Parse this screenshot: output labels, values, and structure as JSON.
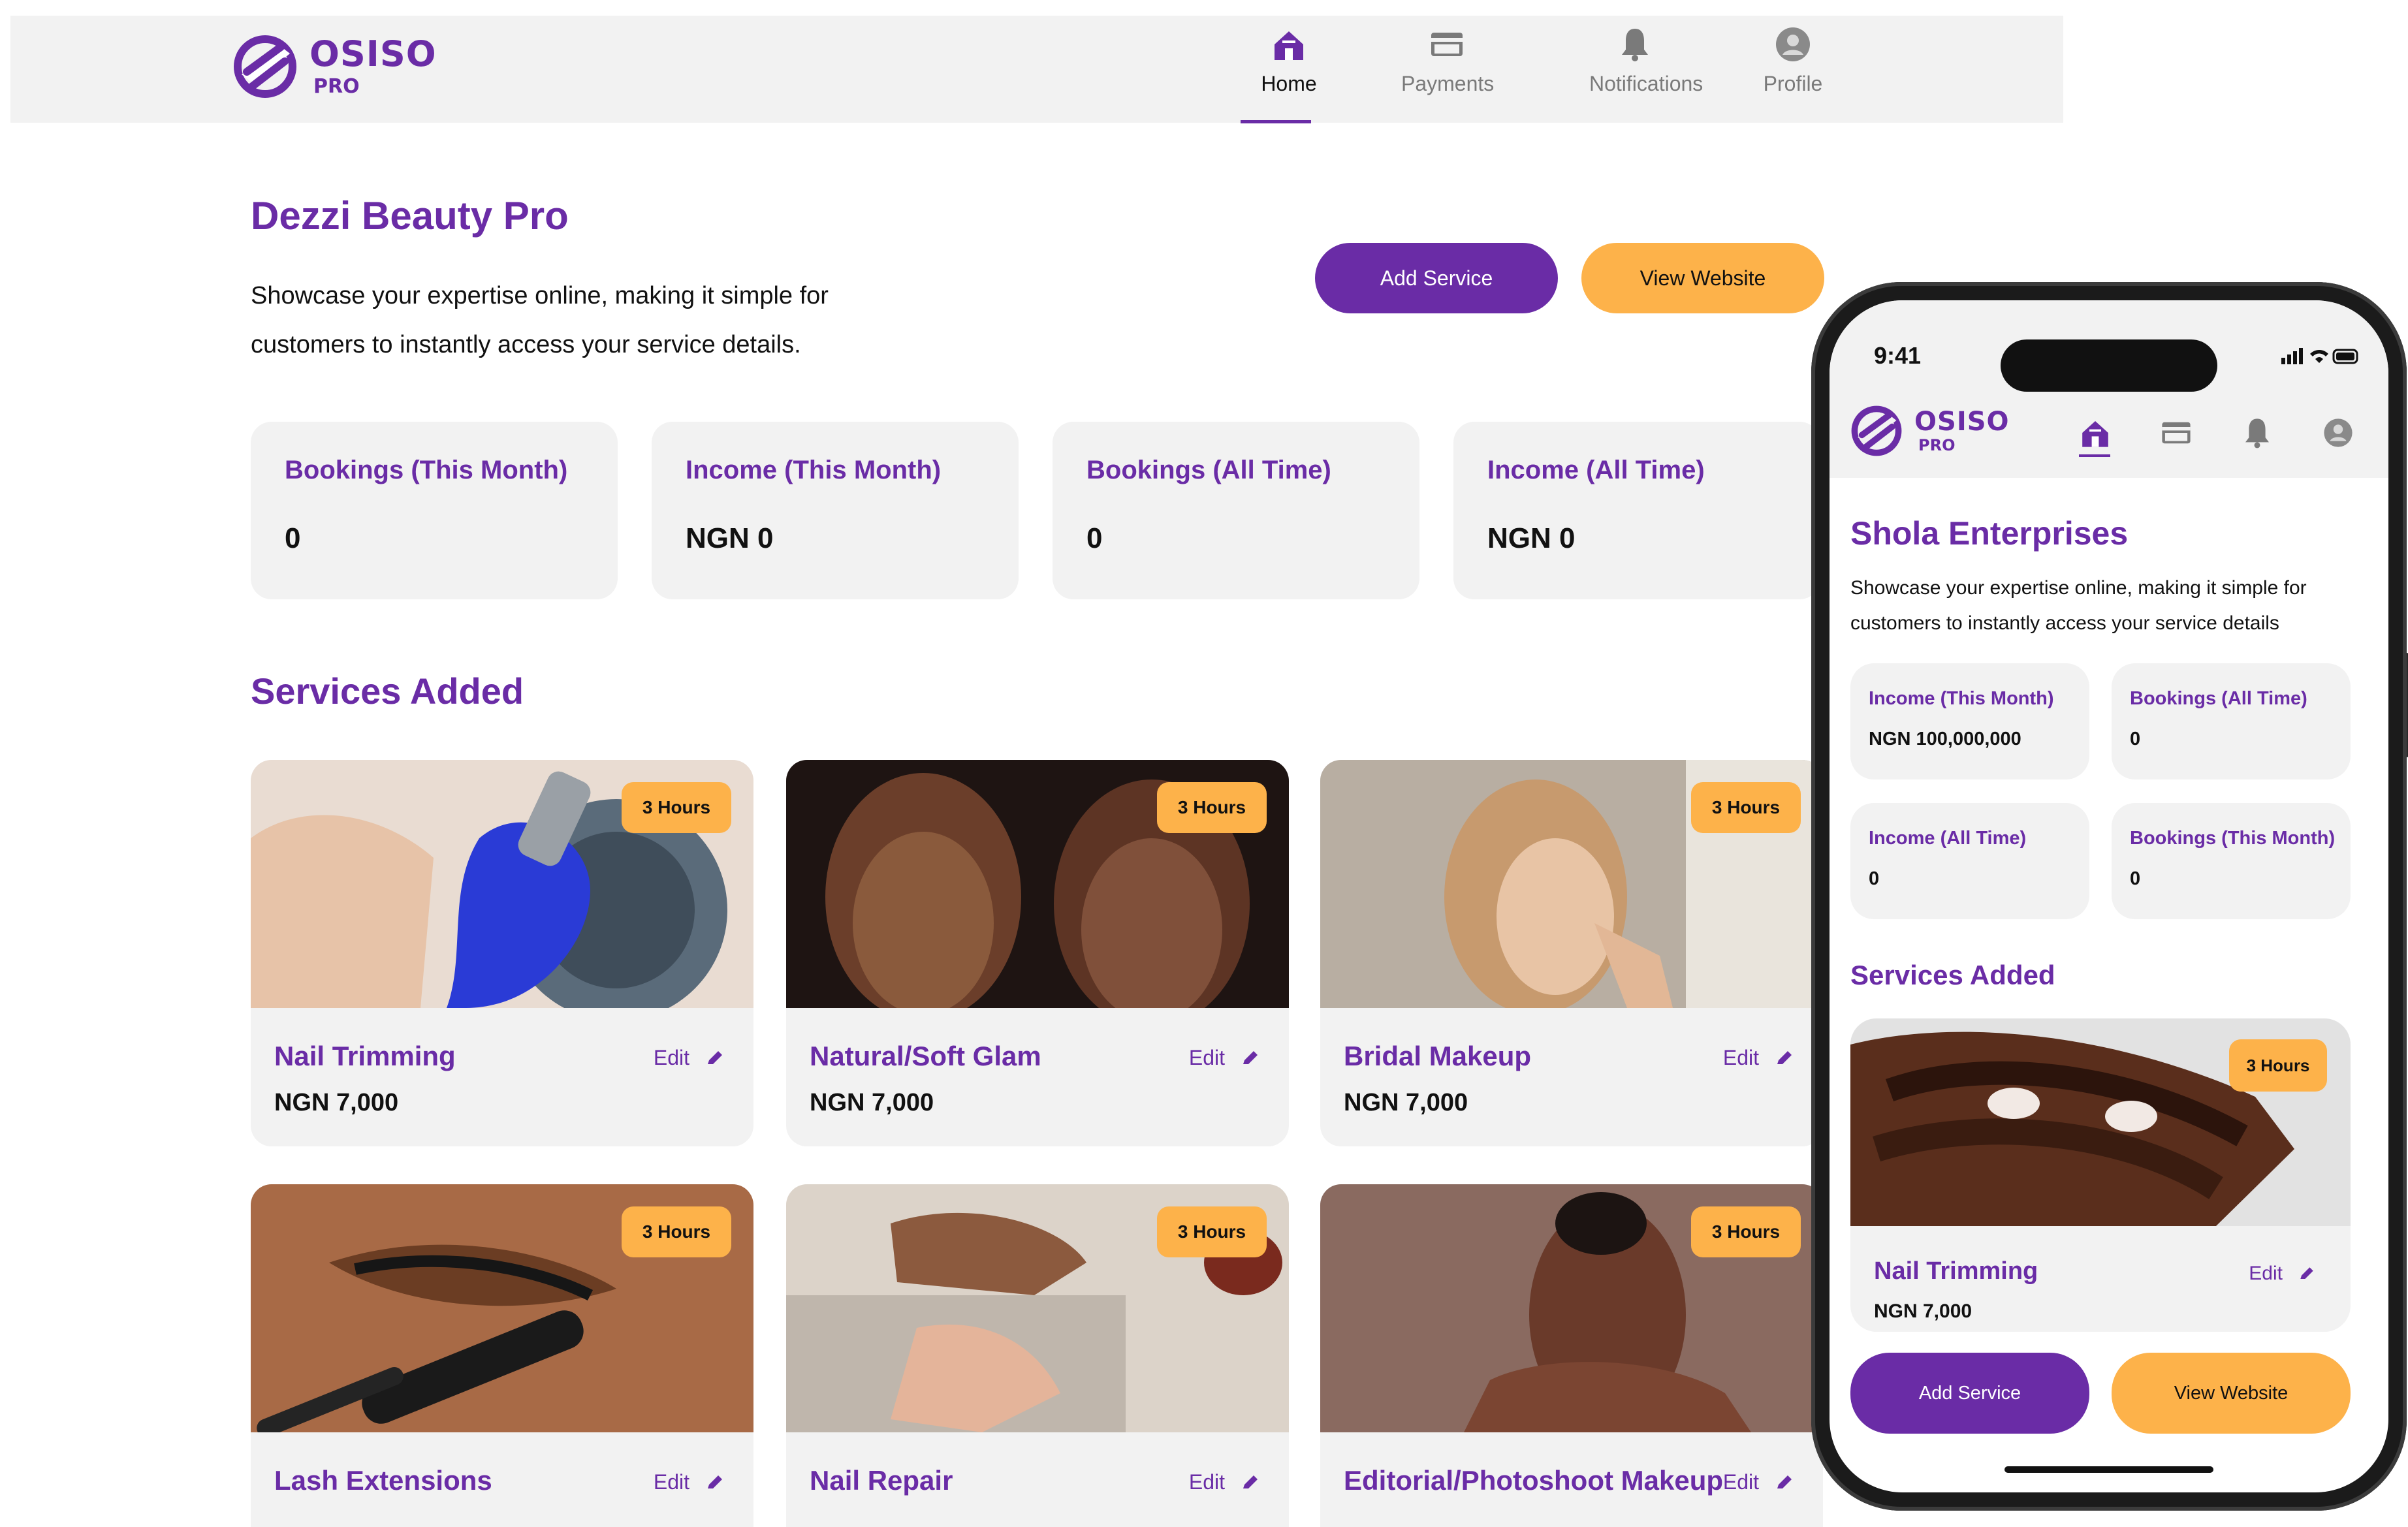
{
  "brand": {
    "name": "OSISO",
    "sub": "PRO"
  },
  "nav": [
    {
      "label": "Home",
      "icon": "home-icon",
      "active": true
    },
    {
      "label": "Payments",
      "icon": "card-icon",
      "active": false
    },
    {
      "label": "Notifications",
      "icon": "bell-icon",
      "active": false
    },
    {
      "label": "Profile",
      "icon": "user-icon",
      "active": false
    }
  ],
  "desktop": {
    "title": "Dezzi Beauty Pro",
    "description_line1": "Showcase your expertise online, making it simple for",
    "description_line2": "customers to instantly access your service details.",
    "add_service": "Add Service",
    "view_website": "View Website",
    "stats": [
      {
        "label": "Bookings (This Month)",
        "value": "0"
      },
      {
        "label": "Income (This Month)",
        "value": "NGN 0"
      },
      {
        "label": "Bookings (All Time)",
        "value": "0"
      },
      {
        "label": "Income (All Time)",
        "value": "NGN 0"
      }
    ],
    "section_title": "Services Added",
    "services": [
      {
        "name": "Nail Trimming",
        "price": "NGN 7,000",
        "duration": "3 Hours",
        "edit": "Edit"
      },
      {
        "name": "Natural/Soft Glam",
        "price": "NGN 7,000",
        "duration": "3 Hours",
        "edit": "Edit"
      },
      {
        "name": "Bridal Makeup",
        "price": "NGN 7,000",
        "duration": "3 Hours",
        "edit": "Edit"
      },
      {
        "name": "Lash Extensions",
        "price": "",
        "duration": "3 Hours",
        "edit": "Edit"
      },
      {
        "name": "Nail Repair",
        "price": "",
        "duration": "3 Hours",
        "edit": "Edit"
      },
      {
        "name": "Editorial/Photoshoot Makeup",
        "price": "",
        "duration": "3 Hours",
        "edit": "Edit"
      }
    ]
  },
  "mobile": {
    "time": "9:41",
    "title": "Shola Enterprises",
    "description_line1": "Showcase your expertise online, making it simple for",
    "description_line2": "customers to instantly access your service details",
    "stats": [
      {
        "label": "Income (This Month)",
        "value": "NGN 100,000,000"
      },
      {
        "label": "Bookings (All Time)",
        "value": "0"
      },
      {
        "label": "Income (All Time)",
        "value": "0"
      },
      {
        "label": "Bookings (This Month)",
        "value": "0"
      }
    ],
    "section_title": "Services Added",
    "service": {
      "name": "Nail Trimming",
      "price": "NGN 7,000",
      "duration": "3 Hours",
      "edit": "Edit"
    },
    "add_service": "Add Service",
    "view_website": "View Website"
  },
  "colors": {
    "accent": "#6a2ca6",
    "secondary": "#fdb24a",
    "card": "#f2f2f2"
  }
}
